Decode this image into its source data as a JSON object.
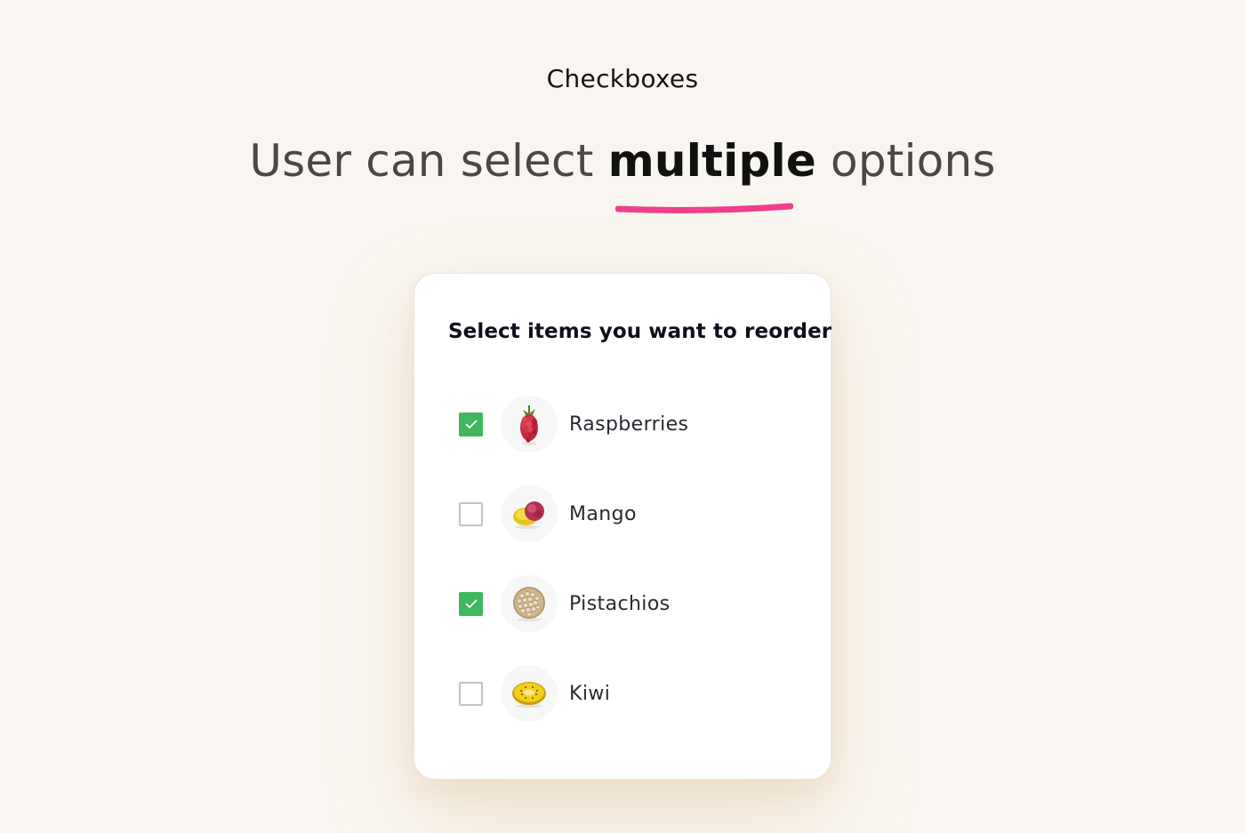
{
  "page": {
    "label": "Checkboxes",
    "headline_before": "User can select ",
    "headline_emphasis": "multiple",
    "headline_after": " options",
    "accent_color": "#ef3f8a",
    "background_color": "#f9f6f1"
  },
  "card": {
    "title": "Select items you want to reorder",
    "check_color": "#3fb85f",
    "items": [
      {
        "label": "Raspberries",
        "checked": true,
        "icon": "raspberry-icon"
      },
      {
        "label": "Mango",
        "checked": false,
        "icon": "mango-icon"
      },
      {
        "label": "Pistachios",
        "checked": true,
        "icon": "pistachios-icon"
      },
      {
        "label": "Kiwi",
        "checked": false,
        "icon": "kiwi-icon"
      }
    ]
  }
}
